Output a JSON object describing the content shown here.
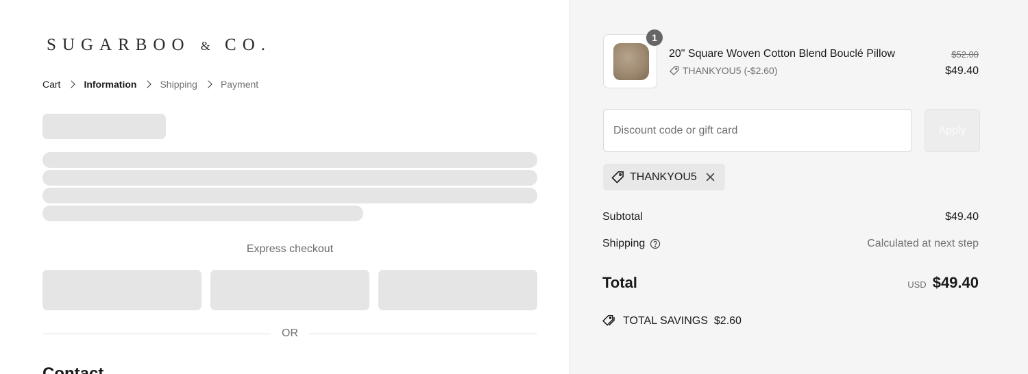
{
  "brand": {
    "logo_main": "SUGARBOO",
    "logo_amp": "&",
    "logo_end": "CO."
  },
  "breadcrumb": [
    {
      "label": "Cart",
      "state": "link"
    },
    {
      "label": "Information",
      "state": "active"
    },
    {
      "label": "Shipping",
      "state": "muted"
    },
    {
      "label": "Payment",
      "state": "muted"
    }
  ],
  "express": {
    "label": "Express checkout",
    "or_label": "OR"
  },
  "contact": {
    "heading": "Contact"
  },
  "cart": {
    "item": {
      "quantity": "1",
      "name": "20\" Square Woven Cotton Blend Bouclé Pillow",
      "discount_line": "THANKYOU5 (-$2.60)",
      "original_price": "$52.00",
      "final_price": "$49.40",
      "image_icon": "pillow-image"
    }
  },
  "discount": {
    "placeholder": "Discount code or gift card",
    "value": "",
    "apply_label": "Apply",
    "applied_code": "THANKYOU5"
  },
  "summary": {
    "subtotal_label": "Subtotal",
    "subtotal_value": "$49.40",
    "shipping_label": "Shipping",
    "shipping_value": "Calculated at next step",
    "total_label": "Total",
    "currency": "USD",
    "total_value": "$49.40",
    "savings_label": "TOTAL SAVINGS",
    "savings_value": "$2.60"
  },
  "icons": [
    "chevron-right-icon",
    "tag-icon",
    "close-icon",
    "question-circle-icon",
    "tags-icon"
  ],
  "colors": {
    "panel_bg": "#f5f5f5",
    "skeleton": "#e5e5e5",
    "muted_text": "#707070",
    "badge": "#666666"
  }
}
